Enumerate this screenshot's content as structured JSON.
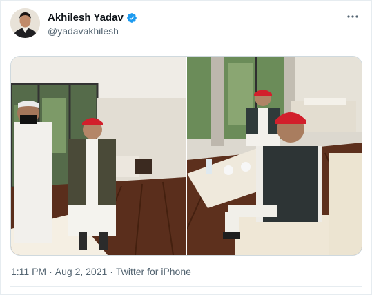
{
  "tweet": {
    "author_name": "Akhilesh Yadav",
    "author_handle": "@yadavakhilesh",
    "time": "1:11 PM",
    "date": "Aug 2, 2021",
    "separator": "·",
    "source": "Twitter for iPhone"
  },
  "icons": {
    "verified": "verified-badge-icon",
    "more": "more-options-icon"
  },
  "colors": {
    "verified_blue": "#1d9bf0",
    "text_primary": "#0f1419",
    "text_secondary": "#536471",
    "border": "#cfd9de",
    "red_cap": "#d21f2b"
  }
}
